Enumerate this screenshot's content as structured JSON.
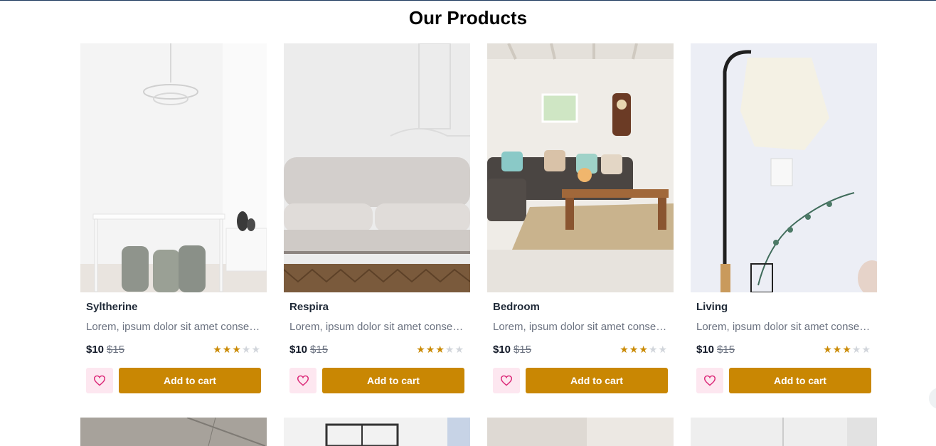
{
  "page": {
    "title": "Our Products"
  },
  "products": [
    {
      "name": "Syltherine",
      "desc": "Lorem, ipsum dolor sit amet consectetur adipisicing elit.",
      "price": "$10",
      "old_price": "$15",
      "rating": 3,
      "cart_label": "Add to cart"
    },
    {
      "name": "Respira",
      "desc": "Lorem, ipsum dolor sit amet consectetur adipisicing elit.",
      "price": "$10",
      "old_price": "$15",
      "rating": 3,
      "cart_label": "Add to cart"
    },
    {
      "name": "Bedroom",
      "desc": "Lorem, ipsum dolor sit amet consectetur adipisicing elit.",
      "price": "$10",
      "old_price": "$15",
      "rating": 3,
      "cart_label": "Add to cart"
    },
    {
      "name": "Living",
      "desc": "Lorem, ipsum dolor sit amet consectetur adipisicing elit.",
      "price": "$10",
      "old_price": "$15",
      "rating": 3,
      "cart_label": "Add to cart"
    }
  ],
  "rating_max": 5,
  "colors": {
    "accent": "#c98703",
    "star": "#ca8a04",
    "wishlist_bg": "#fde7f0",
    "heart": "#db2777"
  },
  "icons": {
    "wishlist": "heart-icon",
    "rating": "star-icon"
  }
}
